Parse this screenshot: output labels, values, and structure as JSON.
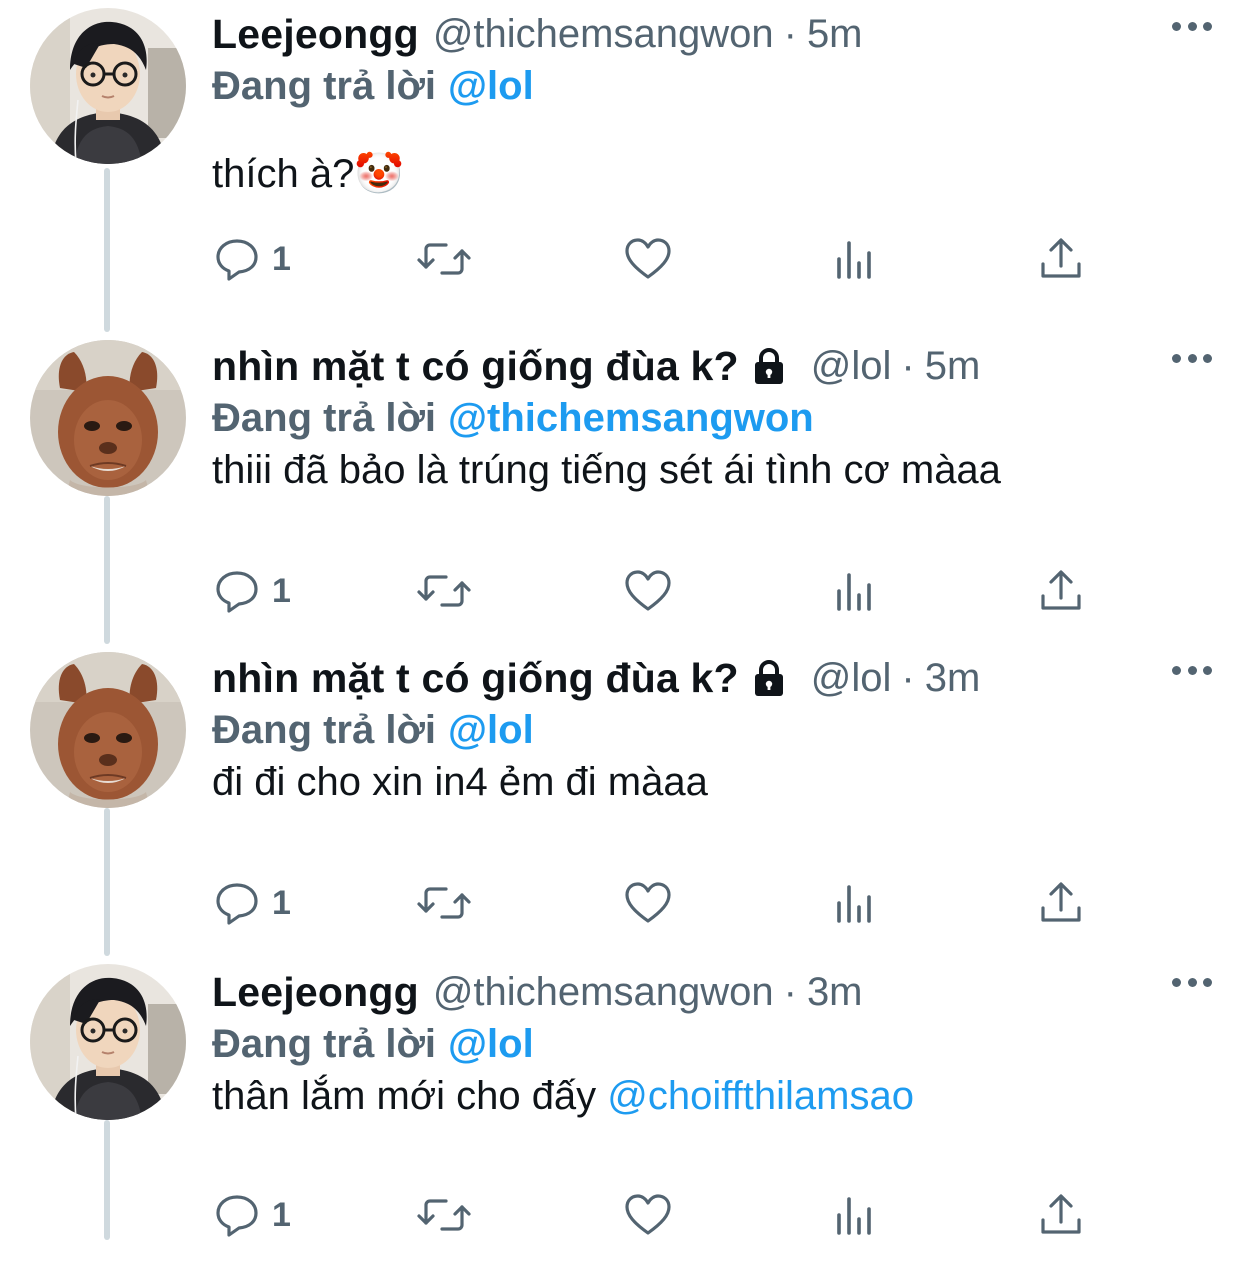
{
  "colors": {
    "link": "#1d9bf0",
    "secondary": "#536471",
    "primary": "#0f1419",
    "thread": "#cfd9de"
  },
  "replying_label": "Đang trả lời",
  "tweets": [
    {
      "name": "Leejeongg",
      "handle": "@thichemsangwon",
      "dot": "·",
      "time": "5m",
      "locked": false,
      "reply_to": "@lol",
      "text": "thích à?🤡",
      "mention": "",
      "reply_count": "1",
      "avatar": "person-glasses"
    },
    {
      "name": "nhìn mặt t có giống đùa k?",
      "handle": "@lol",
      "dot": "·",
      "time": "5m",
      "locked": true,
      "reply_to": "@thichemsangwon",
      "text": "thiii đã bảo là trúng tiếng sét ái tình cơ màaa",
      "mention": "",
      "reply_count": "1",
      "avatar": "dog-face"
    },
    {
      "name": "nhìn mặt t có giống đùa k?",
      "handle": "@lol",
      "dot": "·",
      "time": "3m",
      "locked": true,
      "reply_to": "@lol",
      "text": "đi đi cho xin in4 ẻm đi màaa",
      "mention": "",
      "reply_count": "1",
      "avatar": "dog-face"
    },
    {
      "name": "Leejeongg",
      "handle": "@thichemsangwon",
      "dot": "·",
      "time": "3m",
      "locked": false,
      "reply_to": "@lol",
      "text": "thân lắm mới cho đấy ",
      "mention": "@choiffthilamsao",
      "reply_count": "1",
      "avatar": "person-glasses"
    }
  ]
}
